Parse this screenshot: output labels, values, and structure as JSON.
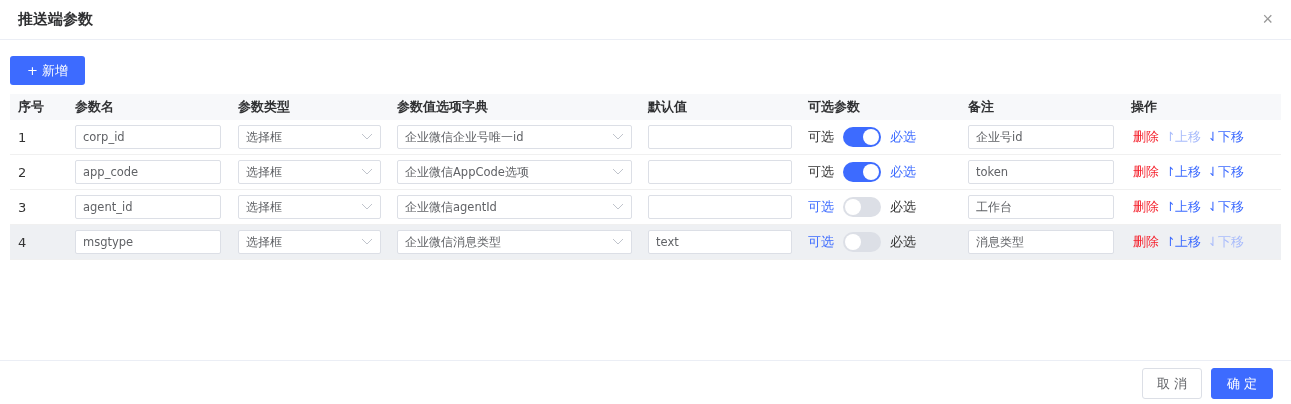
{
  "dialog": {
    "title": "推送端参数",
    "close": "×"
  },
  "add_button": {
    "icon": "+",
    "label": "新增"
  },
  "table": {
    "columns": [
      "序号",
      "参数名",
      "参数类型",
      "参数值选项字典",
      "默认值",
      "可选参数",
      "备注",
      "操作"
    ],
    "rows": [
      {
        "index": "1",
        "name": "corp_id",
        "type": "选择框",
        "dictionary": "企业微信企业号唯一id",
        "optional_label": "可选",
        "required": true,
        "required_label": "必选",
        "remark": "企业号id",
        "delete": "删除",
        "up": {
          "label": "↾上移",
          "disabled": true
        },
        "down": {
          "label": "⇃下移",
          "disabled": false
        },
        "hovered": false
      },
      {
        "index": "2",
        "name": "app_code",
        "type": "选择框",
        "dictionary": "企业微信AppCode选项",
        "optional_label": "可选",
        "required": true,
        "required_label": "必选",
        "remark": "token",
        "delete": "删除",
        "up": {
          "label": "↾上移",
          "disabled": false
        },
        "down": {
          "label": "⇃下移",
          "disabled": false
        },
        "hovered": false
      },
      {
        "index": "3",
        "name": "agent_id",
        "type": "选择框",
        "dictionary": "企业微信agentId",
        "optional_label": "可选",
        "required": false,
        "required_label": "必选",
        "remark": "工作台",
        "delete": "删除",
        "up": {
          "label": "↾上移",
          "disabled": false
        },
        "down": {
          "label": "⇃下移",
          "disabled": false
        },
        "hovered": false
      },
      {
        "index": "4",
        "name": "msgtype",
        "type": "选择框",
        "dictionary": "企业微信消息类型",
        "default": "text",
        "optional_label": "可选",
        "required": false,
        "required_label": "必选",
        "remark": "消息类型",
        "delete": "删除",
        "up": {
          "label": "↾上移",
          "disabled": false
        },
        "down": {
          "label": "⇃下移",
          "disabled": true
        },
        "hovered": true
      }
    ]
  },
  "footer": {
    "cancel": "取 消",
    "confirm": "确 定"
  }
}
